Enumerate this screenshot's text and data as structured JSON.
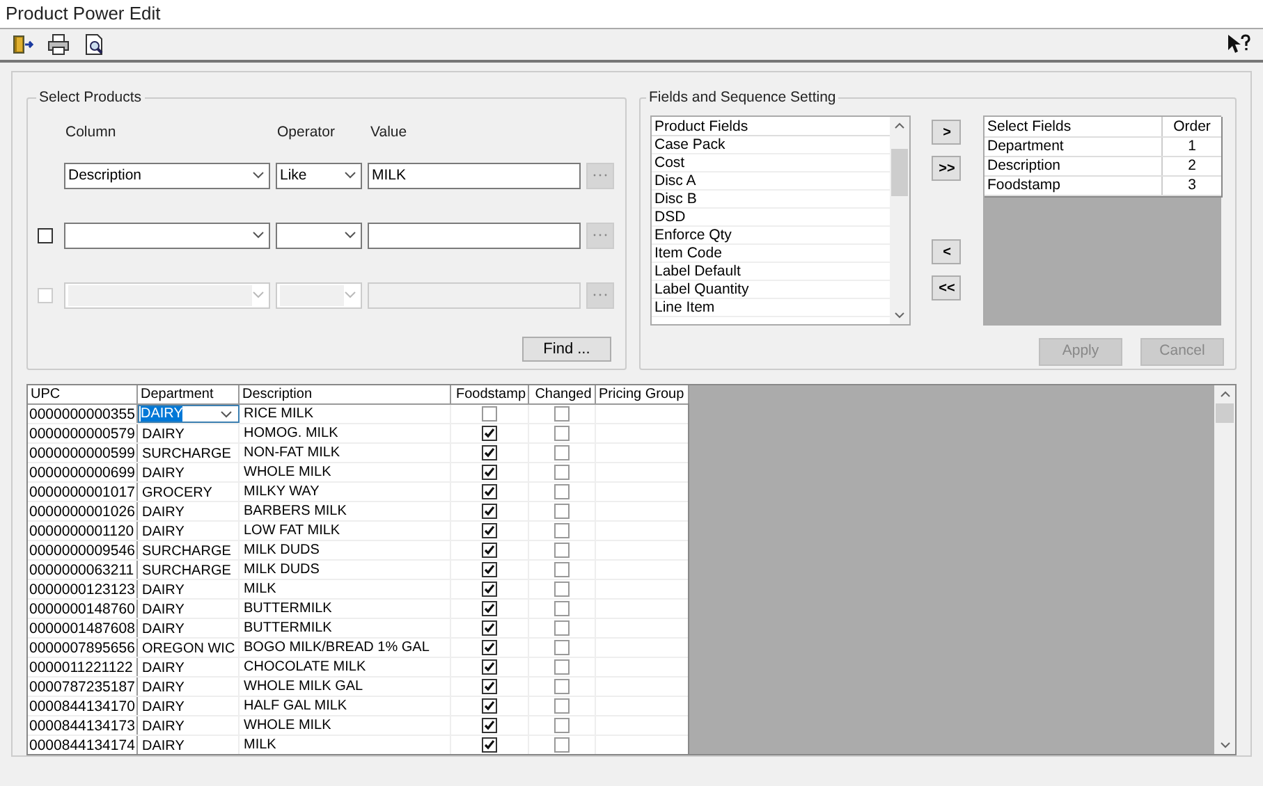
{
  "window": {
    "title": "Product Power Edit"
  },
  "select_products": {
    "title": "Select Products",
    "headers": [
      "Column",
      "Operator",
      "Value"
    ],
    "filters": [
      {
        "kind": "primary",
        "column": "Description",
        "operator": "Like",
        "value": "MILK",
        "disabled": false
      },
      {
        "kind": "optional",
        "checked": false,
        "disabled": false
      },
      {
        "kind": "optional",
        "checked": false,
        "disabled": true
      }
    ],
    "find_button": "Find ..."
  },
  "fields_setting": {
    "title": "Fields and Sequence Setting",
    "product_fields": {
      "header": "Product Fields",
      "items": [
        "Case Pack",
        "Cost",
        "Disc A",
        "Disc B",
        "DSD",
        "Enforce Qty",
        "Item Code",
        "Label Default",
        "Label Quantity",
        "Line Item"
      ]
    },
    "move_buttons": [
      ">",
      ">>",
      "<",
      "<<"
    ],
    "selected_fields": {
      "columns": [
        "Select Fields",
        "Order"
      ],
      "rows": [
        [
          "Department",
          "1"
        ],
        [
          "Description",
          "2"
        ],
        [
          "Foodstamp",
          "3"
        ]
      ]
    },
    "apply_button": {
      "label": "Apply",
      "disabled": true
    },
    "cancel_button": {
      "label": "Cancel",
      "disabled": true
    }
  },
  "grid": {
    "columns": [
      "UPC",
      "Department",
      "Description",
      "Foodstamp",
      "Changed",
      "Pricing Group"
    ],
    "rows": [
      {
        "upc": "0000000000355",
        "department": "DAIRY",
        "description": "RICE MILK",
        "foodstamp": false,
        "changed": false,
        "editing": true
      },
      {
        "upc": "0000000000579",
        "department": "DAIRY",
        "description": "HOMOG. MILK",
        "foodstamp": true,
        "changed": false,
        "editing": false
      },
      {
        "upc": "0000000000599",
        "department": "SURCHARGE",
        "description": "NON-FAT MILK",
        "foodstamp": true,
        "changed": false,
        "editing": false
      },
      {
        "upc": "0000000000699",
        "department": "DAIRY",
        "description": "WHOLE MILK",
        "foodstamp": true,
        "changed": false,
        "editing": false
      },
      {
        "upc": "0000000001017",
        "department": "GROCERY",
        "description": "MILKY WAY",
        "foodstamp": true,
        "changed": false,
        "editing": false
      },
      {
        "upc": "0000000001026",
        "department": "DAIRY",
        "description": "BARBERS MILK",
        "foodstamp": true,
        "changed": false,
        "editing": false
      },
      {
        "upc": "0000000001120",
        "department": "DAIRY",
        "description": "LOW FAT MILK",
        "foodstamp": true,
        "changed": false,
        "editing": false
      },
      {
        "upc": "0000000009546",
        "department": "SURCHARGE",
        "description": "MILK DUDS",
        "foodstamp": true,
        "changed": false,
        "editing": false
      },
      {
        "upc": "0000000063211",
        "department": "SURCHARGE",
        "description": "MILK DUDS",
        "foodstamp": true,
        "changed": false,
        "editing": false
      },
      {
        "upc": "0000000123123",
        "department": "DAIRY",
        "description": "MILK",
        "foodstamp": true,
        "changed": false,
        "editing": false
      },
      {
        "upc": "0000000148760",
        "department": "DAIRY",
        "description": "BUTTERMILK",
        "foodstamp": true,
        "changed": false,
        "editing": false
      },
      {
        "upc": "0000001487608",
        "department": "DAIRY",
        "description": "BUTTERMILK",
        "foodstamp": true,
        "changed": false,
        "editing": false
      },
      {
        "upc": "0000007895656",
        "department": "OREGON WIC",
        "description": "BOGO MILK/BREAD 1% GAL",
        "foodstamp": true,
        "changed": false,
        "editing": false
      },
      {
        "upc": "0000011221122",
        "department": "DAIRY",
        "description": "CHOCOLATE MILK",
        "foodstamp": true,
        "changed": false,
        "editing": false
      },
      {
        "upc": "0000787235187",
        "department": "DAIRY",
        "description": "WHOLE MILK GAL",
        "foodstamp": true,
        "changed": false,
        "editing": false
      },
      {
        "upc": "0000844134170",
        "department": "DAIRY",
        "description": "HALF GAL MILK",
        "foodstamp": true,
        "changed": false,
        "editing": false
      },
      {
        "upc": "0000844134173",
        "department": "DAIRY",
        "description": "WHOLE MILK",
        "foodstamp": true,
        "changed": false,
        "editing": false
      },
      {
        "upc": "0000844134174",
        "department": "DAIRY",
        "description": "MILK",
        "foodstamp": true,
        "changed": false,
        "editing": false
      }
    ]
  }
}
